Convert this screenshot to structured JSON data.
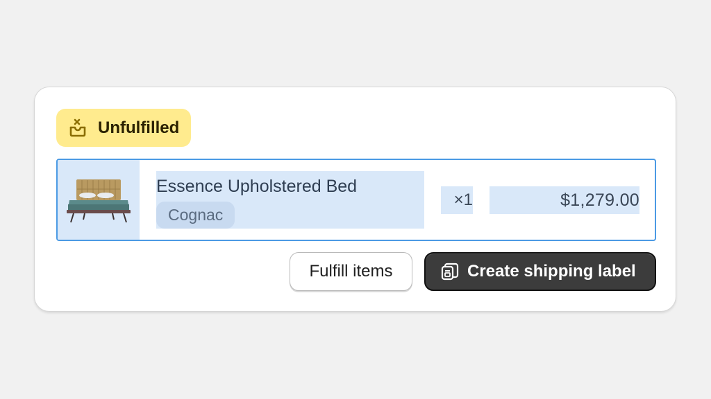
{
  "fulfillment": {
    "status_label": "Unfulfilled",
    "status_icon": "unfulfilled-box-icon",
    "status_color": "#ffeb8e"
  },
  "line_item": {
    "title": "Essence Upholstered Bed",
    "variant": "Cognac",
    "quantity": "×1",
    "price": "$1,279.00",
    "image_icon": "bed-product-image"
  },
  "actions": {
    "fulfill_label": "Fulfill items",
    "shipping_label": "Create shipping label",
    "shipping_icon": "shipping-label-icon"
  }
}
